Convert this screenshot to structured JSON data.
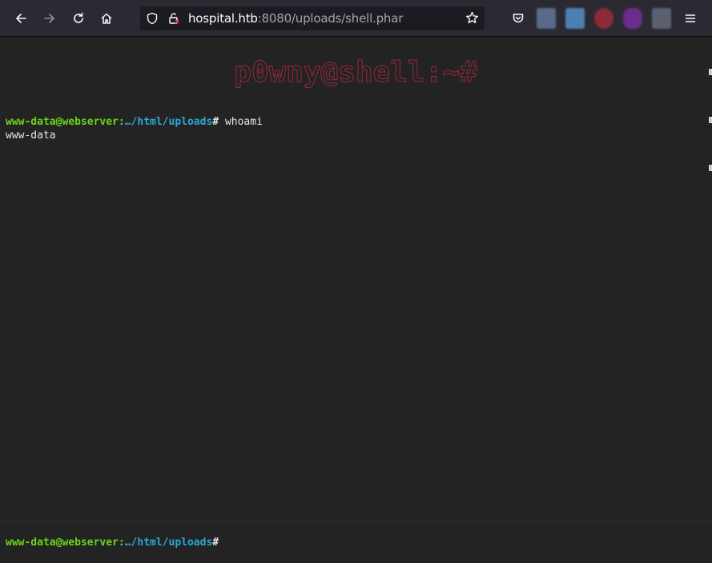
{
  "toolbar": {
    "back_icon": "arrow-left-icon",
    "forward_icon": "arrow-right-icon",
    "reload_icon": "reload-icon",
    "home_icon": "home-icon",
    "url_host": "hospital.htb",
    "url_rest": ":8080/uploads/shell.phar",
    "bookmark_icon": "star-icon",
    "pocket_icon": "pocket-icon",
    "menu_icon": "hamburger-menu-icon",
    "extension_colors": [
      "#5b6a8c",
      "#4d7fb0",
      "#8c2a3a",
      "#6a2d8c",
      "#5a6070"
    ]
  },
  "terminal": {
    "banner": "p0wny@shell:~#",
    "history": [
      {
        "user": "www-data@webserver:",
        "path": "…/html/uploads",
        "hash": "#",
        "command": " whoami",
        "output": "www-data"
      }
    ],
    "input_prompt": {
      "user": "www-data@webserver:",
      "path": "…/html/uploads",
      "hash": "#"
    },
    "input_value": ""
  },
  "colors": {
    "prompt_user": "#6bd41e",
    "prompt_path": "#2aa9d6",
    "banner": "#b0283f",
    "terminal_bg": "#232323"
  }
}
